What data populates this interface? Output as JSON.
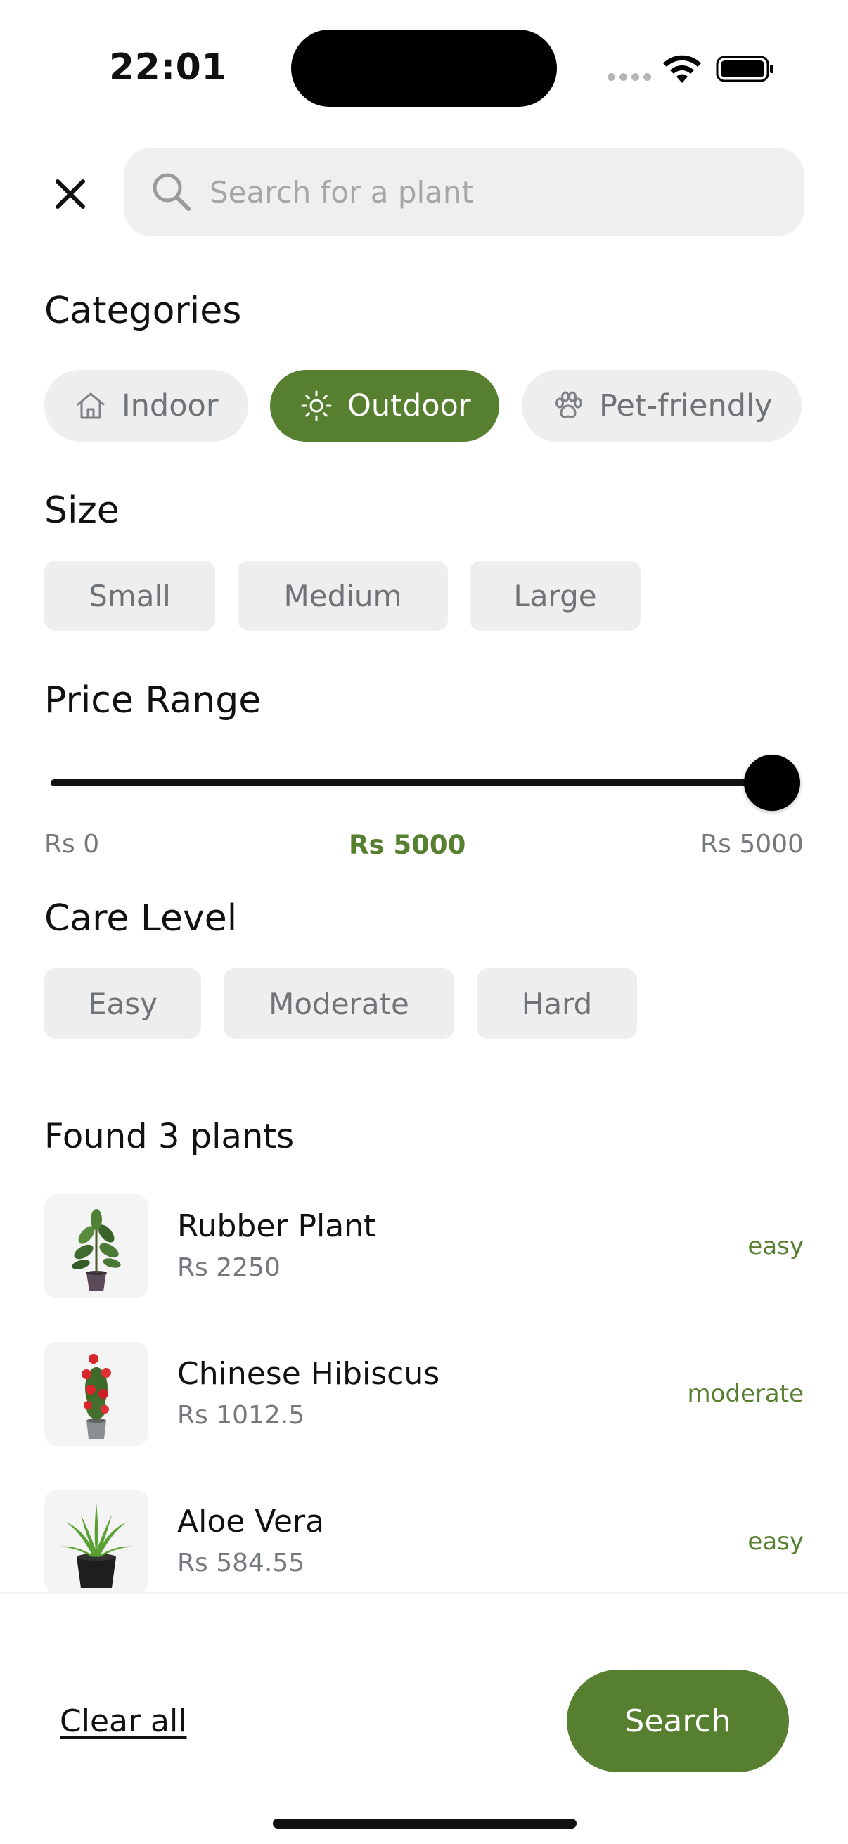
{
  "status_bar": {
    "time": "22:01"
  },
  "search": {
    "placeholder": "Search for a plant"
  },
  "categories": {
    "title": "Categories",
    "items": [
      {
        "label": "Indoor",
        "icon": "home-icon",
        "active": false
      },
      {
        "label": "Outdoor",
        "icon": "sun-icon",
        "active": true
      },
      {
        "label": "Pet-friendly",
        "icon": "paw-icon",
        "active": false
      }
    ]
  },
  "size": {
    "title": "Size",
    "options": [
      "Small",
      "Medium",
      "Large"
    ]
  },
  "price_range": {
    "title": "Price Range",
    "min_label": "Rs 0",
    "current_label": "Rs 5000",
    "max_label": "Rs 5000",
    "value_fraction": 1.0
  },
  "care_level": {
    "title": "Care Level",
    "options": [
      "Easy",
      "Moderate",
      "Hard"
    ]
  },
  "results": {
    "title": "Found 3 plants",
    "items": [
      {
        "name": "Rubber Plant",
        "price": "Rs 2250",
        "care": "easy",
        "image": "rubber-plant-image"
      },
      {
        "name": "Chinese Hibiscus",
        "price": "Rs 1012.5",
        "care": "moderate",
        "image": "hibiscus-image"
      },
      {
        "name": "Aloe Vera",
        "price": "Rs 584.55",
        "care": "easy",
        "image": "aloe-vera-image"
      }
    ]
  },
  "footer": {
    "clear_label": "Clear all",
    "search_label": "Search"
  },
  "colors": {
    "accent": "#577f30",
    "chip_bg": "#eeeeee",
    "muted_text": "#75787d"
  }
}
